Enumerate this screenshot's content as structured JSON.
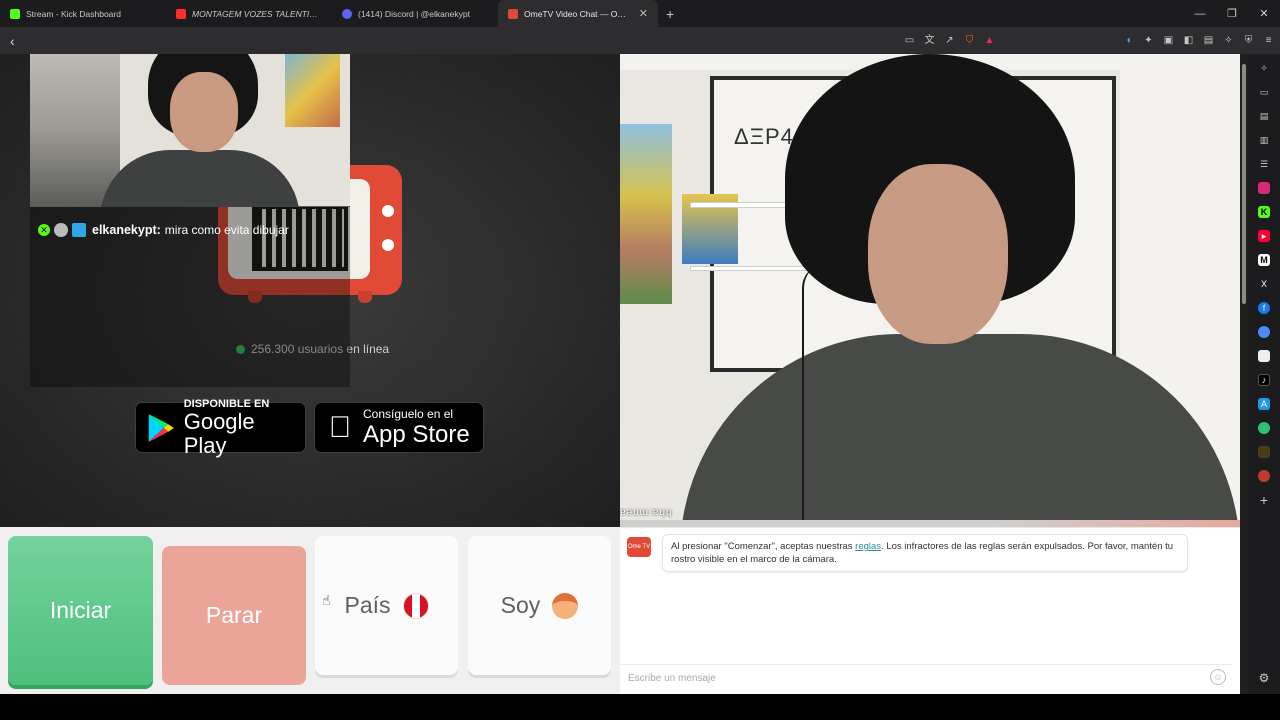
{
  "tabs": [
    {
      "title": "Stream - Kick Dashboard",
      "favicon_color": "#53fc18",
      "active": false
    },
    {
      "title": "MONTAGEM VOZES TALENTINHO",
      "favicon_color": "#ff2e2e",
      "active": false
    },
    {
      "title": "(1414) Discord | @elkanekypt",
      "favicon_color": "#5865f2",
      "active": false
    },
    {
      "title": "OmeTV Video Chat — Omegl",
      "favicon_color": "#e04a37",
      "active": true
    }
  ],
  "new_tab_glyph": "+",
  "window_controls": {
    "minimize": "—",
    "restore": "❐",
    "close": "✕"
  },
  "toolbar": {
    "back_glyph": "‹"
  },
  "overlay_chat": {
    "username": "elkanekypt:",
    "message": "mira como evita dibujar"
  },
  "online_counter": {
    "text": "256.300 usuarios en línea"
  },
  "store_buttons": {
    "google": {
      "small": "DISPONIBLE EN",
      "big": "Google Play"
    },
    "apple": {
      "small": "Consíguelo en el",
      "big": "App Store"
    }
  },
  "partner_video": {
    "frame_text": "ΔΞΡ4",
    "caption": "ɐǝuɯ:ɐɥɥ"
  },
  "controls": {
    "start_label": "Iniciar",
    "stop_label": "Parar",
    "country_label": "País",
    "gender_label": "Soy"
  },
  "chat": {
    "logo_text": "Ome TV",
    "rules_prefix": "Al presionar \"Comenzar\", aceptas nuestras ",
    "rules_link": "reglas",
    "rules_suffix": ". Los infractores de las reglas serán expulsados. Por favor, mantén tu rostro visible en el marco de la cámara.",
    "input_placeholder": "Escribe un mensaje"
  },
  "colors": {
    "start": "#5cc88a",
    "stop": "#eaa598",
    "brand": "#e04a37",
    "online_dot": "#35c25a"
  }
}
